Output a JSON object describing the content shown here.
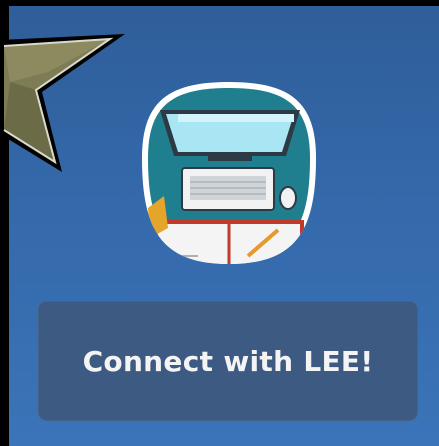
{
  "widget": {
    "connect_label": "Connect with LEE!"
  },
  "icons": {
    "decoration": "star-icon",
    "app": "computer-desk-icon"
  },
  "colors": {
    "background": "#3469aa",
    "button": "#3d5b82",
    "button_text": "#f4f4f4",
    "icon_bg": "#1e7f8e"
  }
}
